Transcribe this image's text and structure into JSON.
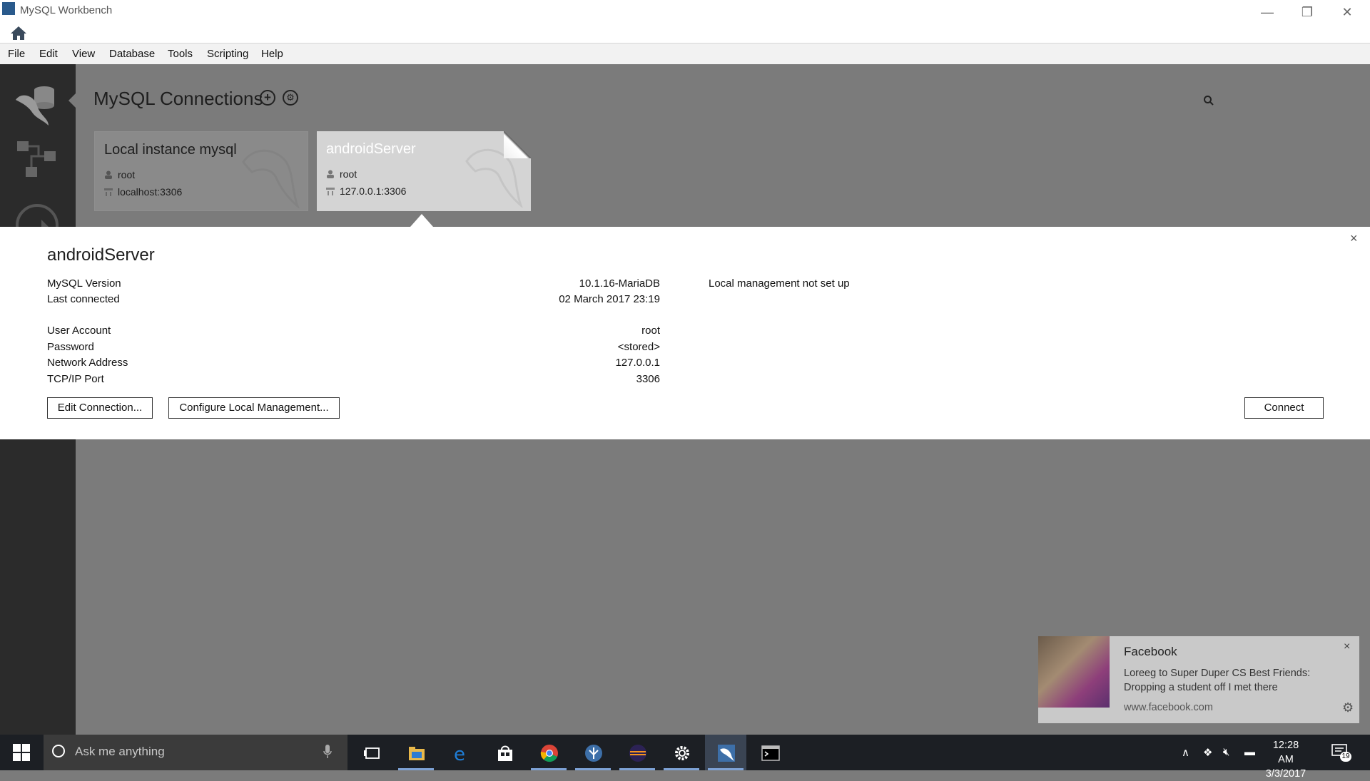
{
  "window": {
    "title": "MySQL Workbench",
    "controls": {
      "minimize": "—",
      "restore": "❐",
      "close": "✕"
    }
  },
  "menu": [
    "File",
    "Edit",
    "View",
    "Database",
    "Tools",
    "Scripting",
    "Help"
  ],
  "connections": {
    "heading": "MySQL Connections",
    "add_symbol": "+",
    "manage_symbol": "⚙",
    "tiles": [
      {
        "title": "Local instance mysql",
        "user": "root",
        "address": "localhost:3306"
      },
      {
        "title": "androidServer",
        "user": "root",
        "address": "127.0.0.1:3306"
      }
    ]
  },
  "details": {
    "title": "androidServer",
    "close_symbol": "×",
    "rows1": [
      {
        "label": "MySQL Version",
        "value": "10.1.16-MariaDB"
      },
      {
        "label": "Last connected",
        "value": "02 March 2017 23:19"
      }
    ],
    "rows2": [
      {
        "label": "User Account",
        "value": "root"
      },
      {
        "label": "Password",
        "value": "<stored>"
      },
      {
        "label": "Network Address",
        "value": "127.0.0.1"
      },
      {
        "label": "TCP/IP Port",
        "value": "3306"
      }
    ],
    "management_note": "Local management not set up",
    "buttons": {
      "edit": "Edit Connection...",
      "configure": "Configure Local Management...",
      "connect": "Connect"
    }
  },
  "toast": {
    "app": "Facebook",
    "message": "Loreeg to Super Duper CS Best Friends: Dropping a student off I met there",
    "url": "www.facebook.com",
    "close_symbol": "×",
    "gear_symbol": "⚙"
  },
  "taskbar": {
    "search_placeholder": "Ask me anything",
    "time": "12:28 AM",
    "date": "3/3/2017",
    "notification_count": "19",
    "apps": [
      "task-view",
      "file-explorer",
      "edge",
      "store",
      "chrome",
      "app-blue",
      "eclipse",
      "settings",
      "mysql-workbench",
      "terminal"
    ]
  },
  "colors": {
    "sidebar": "#2b2b2b",
    "main_bg": "#7b7b7b",
    "taskbar": "#1c1f24",
    "active_tile": "#d4d4d4"
  }
}
